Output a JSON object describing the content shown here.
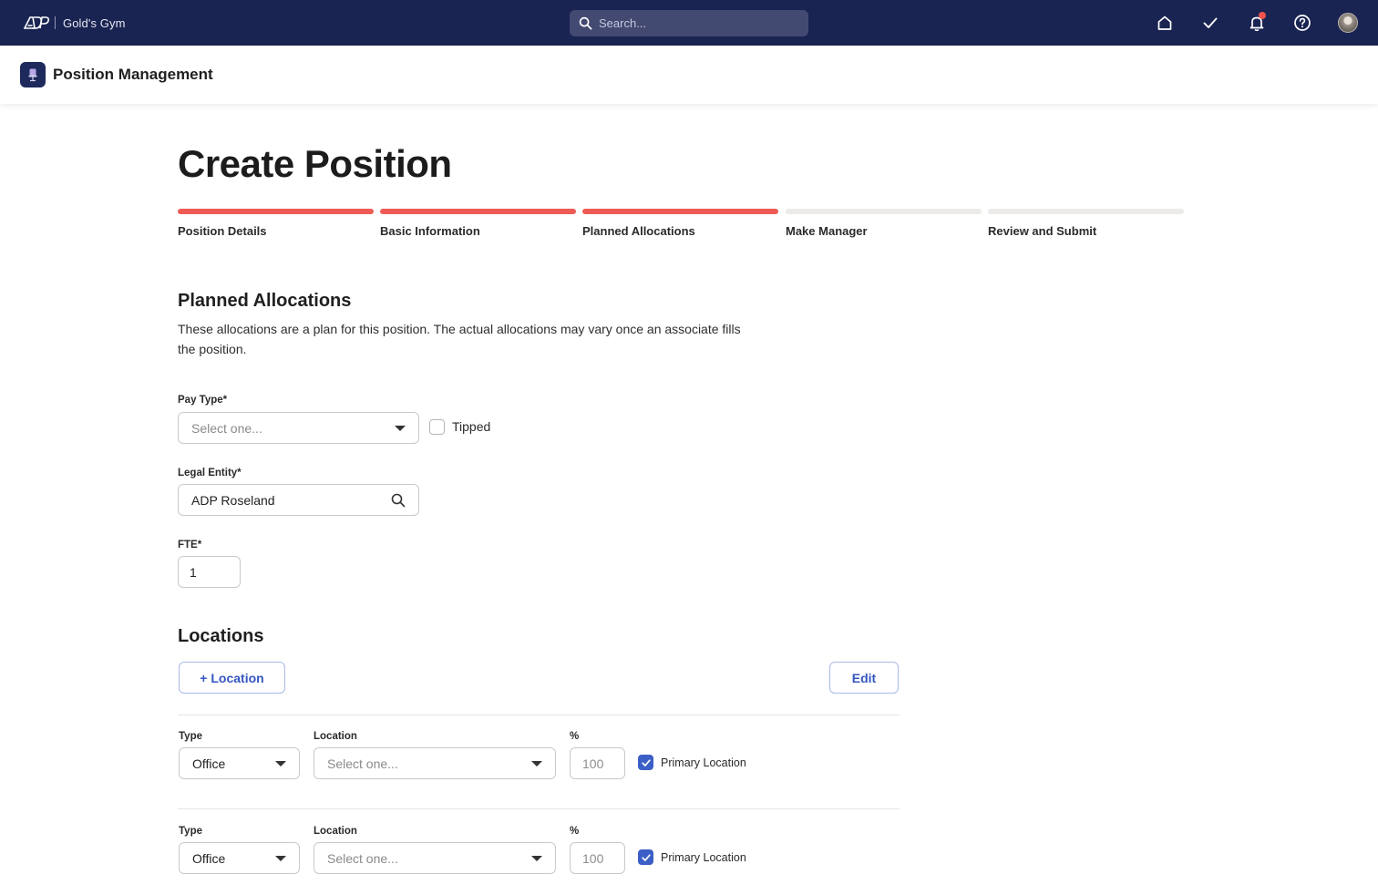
{
  "topbar": {
    "company": "Gold's Gym",
    "search_placeholder": "Search..."
  },
  "app": {
    "title": "Position Management"
  },
  "page": {
    "title": "Create Position"
  },
  "steps": [
    {
      "label": "Position Details",
      "complete": true
    },
    {
      "label": "Basic Information",
      "complete": true
    },
    {
      "label": "Planned Allocations",
      "complete": true
    },
    {
      "label": "Make Manager",
      "complete": false
    },
    {
      "label": "Review and Submit",
      "complete": false
    }
  ],
  "planned": {
    "title": "Planned Allocations",
    "description": "These allocations are a plan for this position. The actual allocations may vary once an associate fills the position.",
    "pay_type_label": "Pay Type*",
    "pay_type_placeholder": "Select one...",
    "tipped_label": "Tipped",
    "legal_entity_label": "Legal Entity*",
    "legal_entity_value": "ADP Roseland",
    "fte_label": "FTE*",
    "fte_value": "1"
  },
  "locations": {
    "title": "Locations",
    "add_button": "+ Location",
    "edit_button": "Edit",
    "rows": [
      {
        "type_label": "Type",
        "type_value": "Office",
        "location_label": "Location",
        "location_placeholder": "Select one...",
        "percent_label": "%",
        "percent_value": "100",
        "primary_label": "Primary Location",
        "primary_checked": true
      },
      {
        "type_label": "Type",
        "type_value": "Office",
        "location_label": "Location",
        "location_placeholder": "Select one...",
        "percent_label": "%",
        "percent_value": "100",
        "primary_label": "Primary Location",
        "primary_checked": true
      }
    ]
  },
  "colors": {
    "topbar": "#1a2452",
    "step_complete": "#ee5b55",
    "step_incomplete": "#ecebe8",
    "accent": "#3c5fc7"
  }
}
